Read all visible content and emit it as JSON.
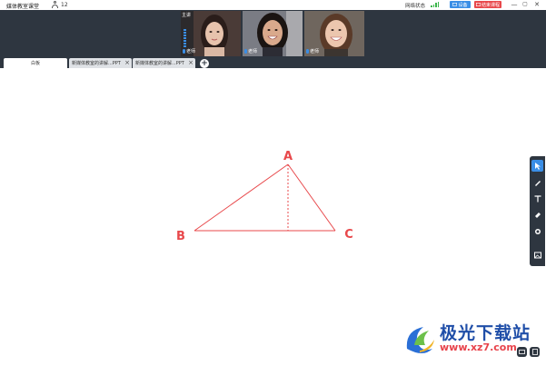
{
  "app": {
    "title": "媒体教室课堂",
    "user_count": "12"
  },
  "status": {
    "network_label": "网络状态",
    "signal_icon": "signal-icon"
  },
  "buttons": {
    "device_label": "设备",
    "end_label": "结束课程"
  },
  "window_controls": [
    "—",
    "▢",
    "✕"
  ],
  "videos": [
    {
      "role_badge": "主讲",
      "name": "老师"
    },
    {
      "name": "老师"
    },
    {
      "name": "老师"
    }
  ],
  "tabs": [
    {
      "label": "白板",
      "closable": false
    },
    {
      "label": "新媒体教室的讲解...PPT",
      "closable": true
    },
    {
      "label": "新媒体教室的讲解...PPT",
      "closable": true
    }
  ],
  "tab_add_label": "+",
  "whiteboard": {
    "labels": {
      "a": "A",
      "b": "B",
      "c": "C"
    },
    "stroke_color": "#e8484b"
  },
  "toolbar": {
    "tools": [
      "pointer-icon",
      "pen-icon",
      "text-icon",
      "eraser-icon",
      "color-icon",
      "image-icon"
    ],
    "active_index": 0
  },
  "watermark": {
    "title": "极光下载站",
    "url": "www.xz7.com"
  },
  "colors": {
    "dark_bar": "#2e3640",
    "accent": "#3a8ee6",
    "danger": "#e8484b"
  }
}
